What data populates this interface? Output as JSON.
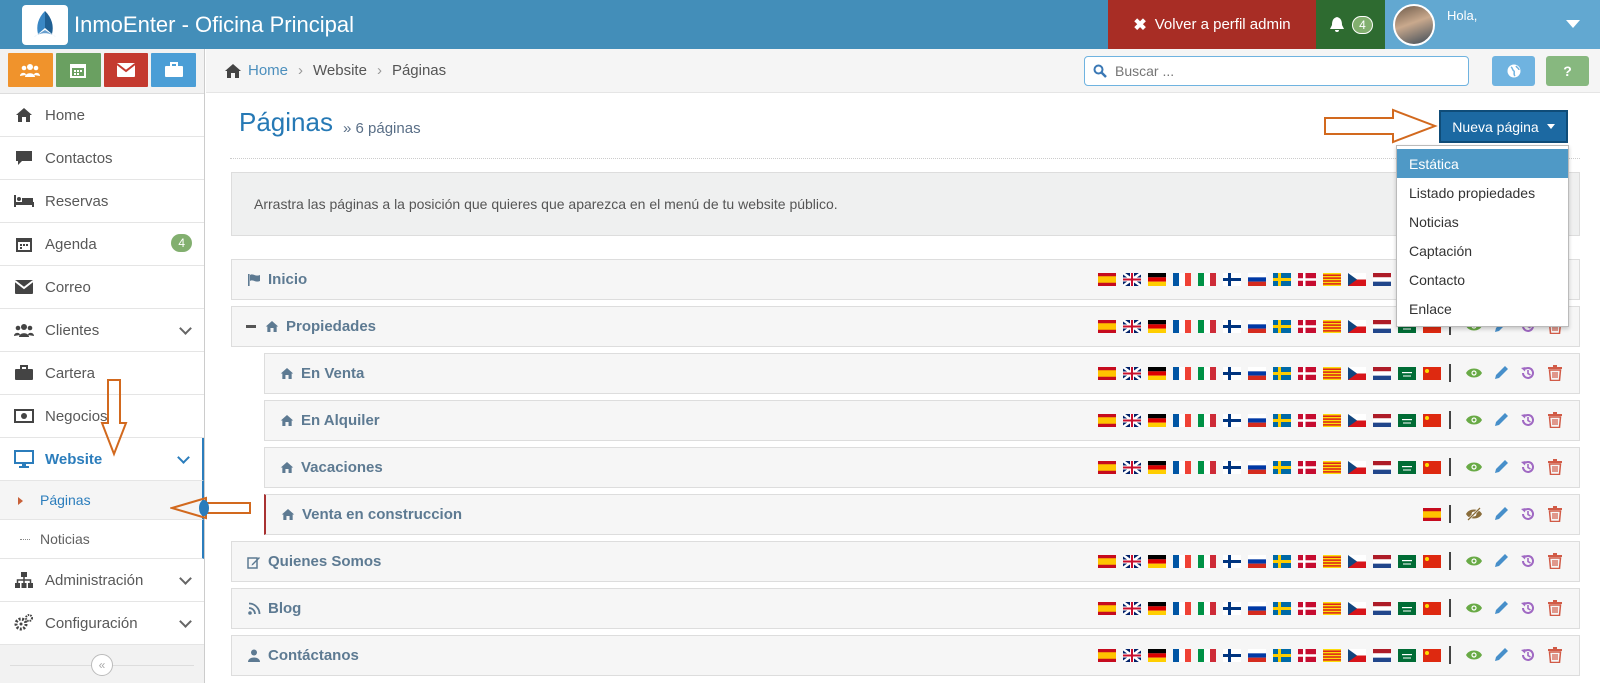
{
  "app": {
    "title": "InmoEnter - Oficina Principal"
  },
  "navbar": {
    "admin_button": "Volver a perfil admin",
    "notifications_count": "4",
    "user_greeting": "Hola,"
  },
  "shortcuts": [
    {
      "icon": "users-icon",
      "color": "#f0932c"
    },
    {
      "icon": "calendar-icon",
      "color": "#6aa061"
    },
    {
      "icon": "envelope-icon",
      "color": "#c43a2f"
    },
    {
      "icon": "briefcase-icon",
      "color": "#4b9ed6"
    }
  ],
  "sidebar": {
    "items": [
      {
        "label": "Home",
        "icon": "home-icon"
      },
      {
        "label": "Contactos",
        "icon": "comment-icon"
      },
      {
        "label": "Reservas",
        "icon": "bed-icon"
      },
      {
        "label": "Agenda",
        "icon": "calendar-icon",
        "badge": "4"
      },
      {
        "label": "Correo",
        "icon": "envelope-icon"
      },
      {
        "label": "Clientes",
        "icon": "users-icon"
      },
      {
        "label": "Cartera",
        "icon": "briefcase-icon"
      },
      {
        "label": "Negocios",
        "icon": "money-icon"
      },
      {
        "label": "Website",
        "icon": "desktop-icon"
      },
      {
        "label": "Administración",
        "icon": "sitemap-icon"
      },
      {
        "label": "Configuración",
        "icon": "cogs-icon"
      }
    ],
    "website_sub": [
      {
        "label": "Páginas"
      },
      {
        "label": "Noticias"
      }
    ]
  },
  "breadcrumb": {
    "home": "Home",
    "section": "Website",
    "current": "Páginas"
  },
  "search": {
    "placeholder": "Buscar ..."
  },
  "page": {
    "title": "Páginas",
    "subtitle": "6 páginas",
    "new_button": "Nueva página",
    "alert": "Arrastra las páginas a la posición que quieres que aparezca en el menú de tu website público."
  },
  "new_menu": {
    "options": [
      "Estática",
      "Listado propiedades",
      "Noticias",
      "Captación",
      "Contacto",
      "Enlace"
    ],
    "selected": "Estática"
  },
  "pages": [
    {
      "label": "Inicio",
      "icon": "flag-icon"
    },
    {
      "label": "Propiedades",
      "icon": "home-icon"
    },
    {
      "label": "En Venta",
      "icon": "home-icon"
    },
    {
      "label": "En Alquiler",
      "icon": "home-icon"
    },
    {
      "label": "Vacaciones",
      "icon": "home-icon"
    },
    {
      "label": "Venta en construccion",
      "icon": "home-icon"
    },
    {
      "label": "Quienes Somos",
      "icon": "edit-icon"
    },
    {
      "label": "Blog",
      "icon": "rss-icon"
    },
    {
      "label": "Contáctanos",
      "icon": "user-icon"
    }
  ],
  "language_flags": [
    "es",
    "gb",
    "de",
    "fr",
    "it",
    "fi",
    "ru",
    "se",
    "dk",
    "ca",
    "cz",
    "nl",
    "sa",
    "cn"
  ],
  "colors": {
    "navbar": "#438eb9",
    "admin_button": "#a82d25",
    "primary_button": "#1c69a2",
    "view": "#69aa46",
    "edit": "#478fca",
    "history": "#a069c3",
    "delete": "#d15b47",
    "annotation_arrow": "#d2691e"
  }
}
